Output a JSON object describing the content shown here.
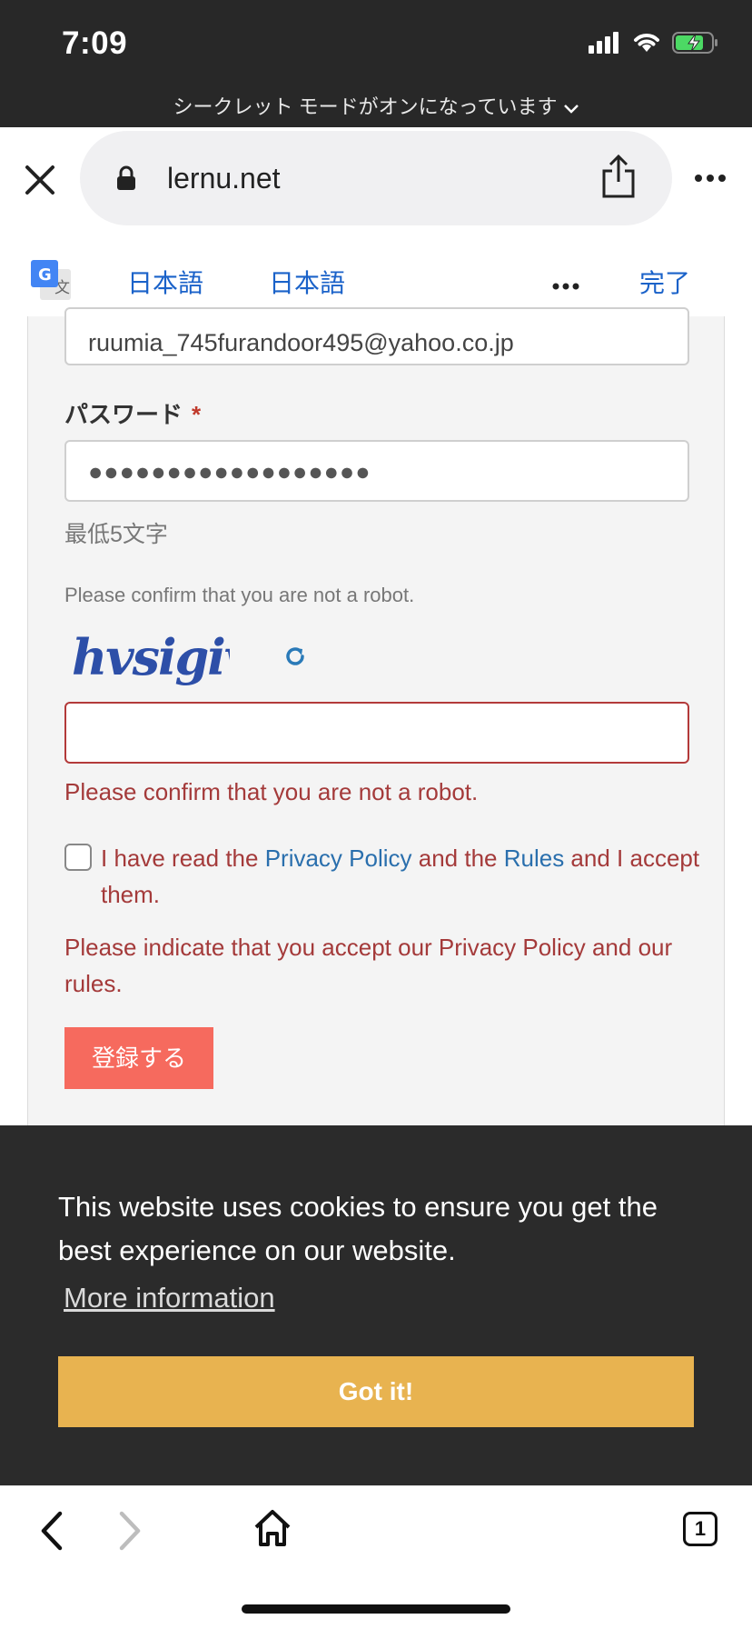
{
  "status_bar": {
    "time": "7:09",
    "incognito_banner": "シークレット モードがオンになっています"
  },
  "browser": {
    "url": "lernu.net"
  },
  "translate_bar": {
    "source_lang": "日本語",
    "target_lang": "日本語",
    "done_label": "完了"
  },
  "form": {
    "email_value": "ruumia_745furandoor495@yahoo.co.jp",
    "password_label": "パスワード",
    "required_mark": "*",
    "password_value": "●●●●●●●●●●●●●●●●●●",
    "password_hint": "最低5文字",
    "captcha_prompt": "Please confirm that you are not a robot.",
    "captcha_text": "hvsigiv",
    "captcha_input_value": "",
    "captcha_error": "Please confirm that you are not a robot.",
    "consent_prefix": "I have read the ",
    "privacy_link": "Privacy Policy",
    "consent_middle": " and the ",
    "rules_link": "Rules",
    "consent_suffix": " and I accept them.",
    "consent_error": "Please indicate that you accept our Privacy Policy and our rules.",
    "submit_label": "登録する"
  },
  "cookie_banner": {
    "message": "This website uses cookies to ensure you get the best experience on our website.",
    "more_info_label": "More information",
    "accept_label": "Got it!"
  },
  "toolbar": {
    "tab_count": "1"
  },
  "colors": {
    "accent_blue": "#1a62c9",
    "error_red": "#a43a3a",
    "submit_coral": "#f66a5e",
    "cookie_bg": "#2b2b2b",
    "cookie_button": "#e8b350"
  },
  "icons": {
    "close": "close-icon",
    "lock": "lock-icon",
    "share": "share-icon",
    "more": "more-icon",
    "translate": "google-translate-icon",
    "refresh": "refresh-icon",
    "back": "back-icon",
    "forward": "forward-icon",
    "home": "home-icon",
    "tabs": "tabs-icon"
  }
}
